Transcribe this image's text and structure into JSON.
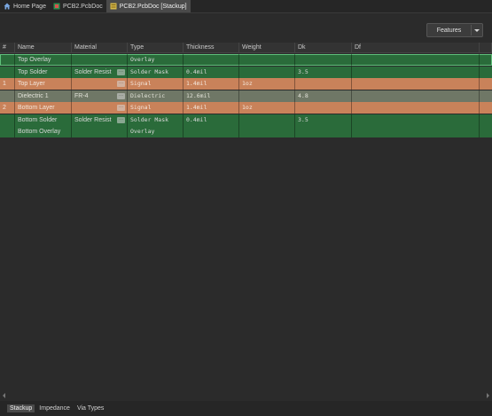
{
  "tabs": [
    {
      "label": "Home Page",
      "icon": "home-icon"
    },
    {
      "label": "PCB2.PcbDoc",
      "icon": "pcb-doc-icon"
    },
    {
      "label": "PCB2.PcbDoc [Stackup]",
      "icon": "stackup-doc-icon"
    }
  ],
  "toolbar": {
    "features_label": "Features"
  },
  "table": {
    "headers": [
      "#",
      "Name",
      "Material",
      "Type",
      "Thickness",
      "Weight",
      "Dk",
      "Df"
    ],
    "rows": [
      {
        "num": "",
        "name": "Top Overlay",
        "material": "",
        "type": "Overlay",
        "thickness": "",
        "weight": "",
        "dk": "",
        "df": "",
        "kind": "overlay"
      },
      {
        "num": "",
        "name": "Top Solder",
        "material": "Solder Resist",
        "type": "Solder Mask",
        "thickness": "0.4mil",
        "weight": "",
        "dk": "3.5",
        "df": "",
        "kind": "solder"
      },
      {
        "num": "1",
        "name": "Top Layer",
        "material": "",
        "type": "Signal",
        "thickness": "1.4mil",
        "weight": "1oz",
        "dk": "",
        "df": "",
        "kind": "signal"
      },
      {
        "num": "",
        "name": "Dielectric 1",
        "material": "FR-4",
        "type": "Dielectric",
        "thickness": "12.6mil",
        "weight": "",
        "dk": "4.8",
        "df": "",
        "kind": "dielectric"
      },
      {
        "num": "2",
        "name": "Bottom Layer",
        "material": "",
        "type": "Signal",
        "thickness": "1.4mil",
        "weight": "1oz",
        "dk": "",
        "df": "",
        "kind": "signal"
      },
      {
        "num": "",
        "name": "Bottom Solder",
        "material": "Solder Resist",
        "type": "Solder Mask",
        "thickness": "0.4mil",
        "weight": "",
        "dk": "3.5",
        "df": "",
        "kind": "solder"
      },
      {
        "num": "",
        "name": "Bottom Overlay",
        "material": "",
        "type": "Overlay",
        "thickness": "",
        "weight": "",
        "dk": "",
        "df": "",
        "kind": "overlay"
      }
    ]
  },
  "bottom_tabs": [
    "Stackup",
    "Impedance",
    "Via Types"
  ],
  "colors": {
    "overlay": "#2a6b3a",
    "solder": "#2a6b3a",
    "signal": "#c9825a",
    "dielectric": "#6f7766"
  }
}
